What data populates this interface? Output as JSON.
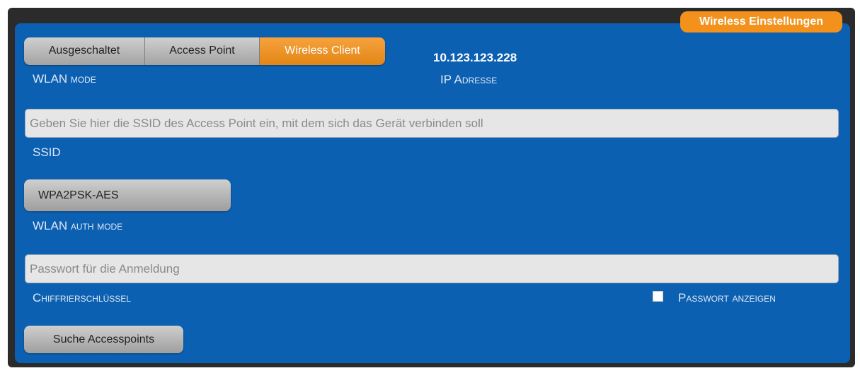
{
  "header": {
    "title": "Wireless Einstellungen"
  },
  "wlan_mode": {
    "options": [
      "Ausgeschaltet",
      "Access Point",
      "Wireless Client"
    ],
    "selected": "Wireless Client",
    "label": "WLAN mode"
  },
  "ip": {
    "value": "10.123.123.228",
    "label": "IP Adresse"
  },
  "ssid": {
    "value": "",
    "placeholder": "Geben Sie hier die SSID des Access Point ein, mit dem sich das Gerät verbinden soll",
    "label": "SSID"
  },
  "auth_mode": {
    "value": "WPA2PSK-AES",
    "label": "WLAN auth mode"
  },
  "password": {
    "value": "",
    "placeholder": "Passwort für die Anmeldung",
    "label": "Chiffrierschlüssel",
    "show_label": "Passwort anzeigen",
    "show_checked": false
  },
  "actions": {
    "scan_label": "Suche Accesspoints"
  },
  "colors": {
    "panel": "#0c60b1",
    "accent": "#f2921c",
    "frame": "#2b2b2b"
  }
}
